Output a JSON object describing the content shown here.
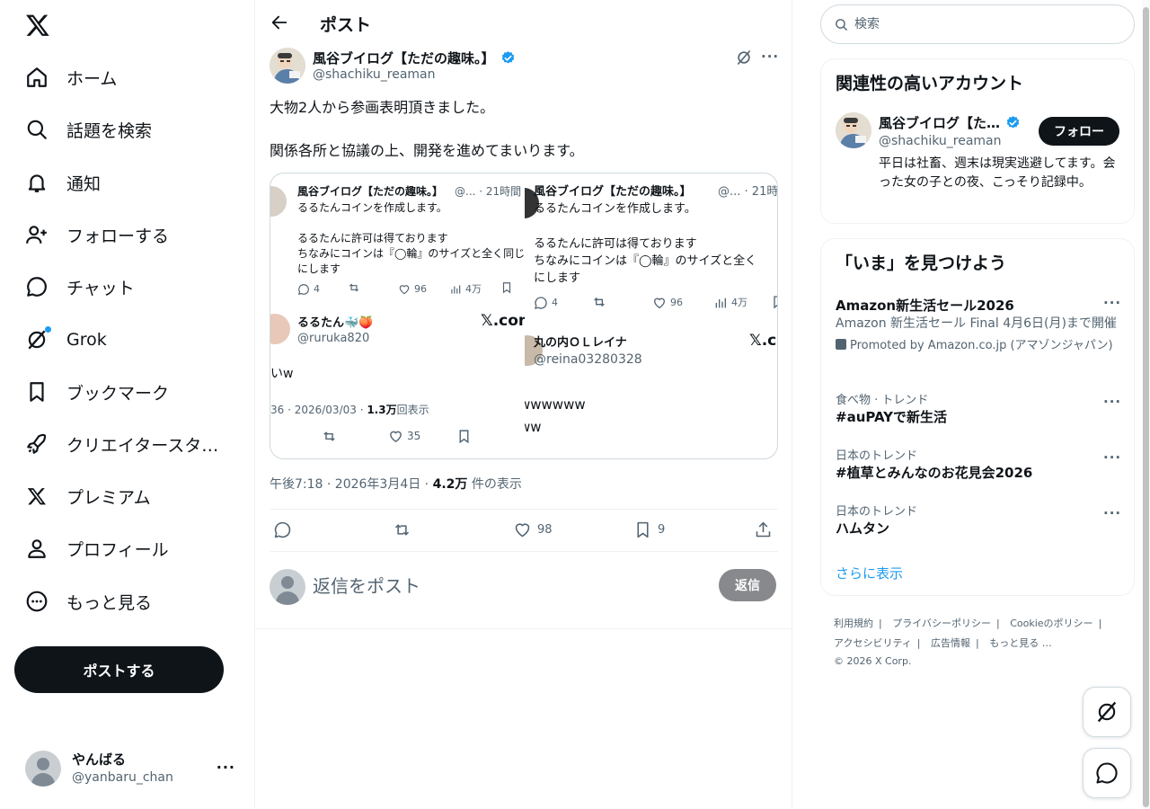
{
  "nav": {
    "items": [
      {
        "label": "ホーム",
        "icon": "home-icon"
      },
      {
        "label": "話題を検索",
        "icon": "search-icon"
      },
      {
        "label": "通知",
        "icon": "bell-icon"
      },
      {
        "label": "フォローする",
        "icon": "follow-icon"
      },
      {
        "label": "チャット",
        "icon": "chat-icon"
      },
      {
        "label": "Grok",
        "icon": "grok-icon"
      },
      {
        "label": "ブックマーク",
        "icon": "bookmark-icon"
      },
      {
        "label": "クリエイタースタ…",
        "icon": "rocket-icon"
      },
      {
        "label": "プレミアム",
        "icon": "x-premium-icon"
      },
      {
        "label": "プロフィール",
        "icon": "person-icon"
      },
      {
        "label": "もっと見る",
        "icon": "more-circle-icon"
      }
    ],
    "post_button": "ポストする",
    "account": {
      "name": "やんばる",
      "handle": "@yanbaru_chan",
      "more": "···"
    }
  },
  "main": {
    "title": "ポスト",
    "post": {
      "author_name": "風谷ブイログ【ただの趣味。】",
      "author_handle": "@shachiku_reaman",
      "text": "大物2人から参画表明頂きました。\n\n関係各所と協議の上、開発を進めてまいります。",
      "timestamp": "午後7:18 · 2026年3月4日 · ",
      "views_count": "4.2万",
      "views_label": " 件の表示",
      "replies": "",
      "reposts": "",
      "likes": "98",
      "bookmarks": "9"
    },
    "media": {
      "left": {
        "q_name": "風谷ブイログ【ただの趣味。】",
        "q_meta": "@... · 21時間",
        "q_line1": "るるたんコインを作成します。",
        "q_line2": "るるたんに許可は得ております",
        "q_line3": "ちなみにコインは『◯輪』のサイズと全く同じ",
        "q_line4": "にします",
        "q_replies": "4",
        "q_likes": "96",
        "q_views": "4万",
        "r_name": "るるたん🐳🍑",
        "r_handle": "@ruruka820",
        "r_xcom": "𝕏.com",
        "r_text": "いw",
        "r_meta_pre": "36 · 2026/03/03 · ",
        "r_meta_views": "1.3万",
        "r_meta_post": "回表示",
        "r_likes": "35"
      },
      "right": {
        "q_name": "風谷ブイログ【ただの趣味。】",
        "q_meta": "@... · 21時間",
        "q_line1": "るるたんコインを作成します。",
        "q_line2": "るるたんに許可は得ております",
        "q_line3": "ちなみにコインは『◯輪』のサイズと全く",
        "q_line4": "にします",
        "q_replies": "4",
        "q_likes": "96",
        "q_views": "4万",
        "r_name": "丸の内ＯＬレイナ",
        "r_handle": "@reina03280328",
        "r_xcom": "𝕏.c",
        "r_text1": "wwwwww",
        "r_text2": "ww"
      }
    },
    "reply": {
      "placeholder": "返信をポスト",
      "button": "返信"
    }
  },
  "right": {
    "search_placeholder": "検索",
    "related": {
      "title": "関連性の高いアカウント",
      "name": "風谷ブイログ【た…",
      "handle": "@shachiku_reaman",
      "follow": "フォロー",
      "bio": "平日は社畜、週末は現実逃避してます。会った女の子との夜、こっそり記録中。"
    },
    "trends": {
      "title": "「いま」を見つけよう",
      "items": [
        {
          "title": "Amazon新生活セール2026",
          "desc": "Amazon 新生活セール Final 4月6日(月)まで開催",
          "promo": "Promoted by Amazon.co.jp (アマゾンジャパン)"
        },
        {
          "context": "食べ物 · トレンド",
          "title": "#auPAYで新生活"
        },
        {
          "context": "日本のトレンド",
          "title": "#植草とみんなのお花見会2026"
        },
        {
          "context": "日本のトレンド",
          "title": "ハムタン"
        }
      ],
      "show_more": "さらに表示"
    },
    "footer": {
      "terms": "利用規約",
      "privacy": "プライバシーポリシー",
      "cookie": "Cookieのポリシー",
      "accessibility": "アクセシビリティ",
      "ads": "広告情報",
      "more": "もっと見る …",
      "copyright": "© 2026 X Corp."
    }
  },
  "colors": {
    "accent": "#1d9bf0",
    "text": "#0f1419",
    "muted": "#536471",
    "border": "#eff3f4"
  }
}
